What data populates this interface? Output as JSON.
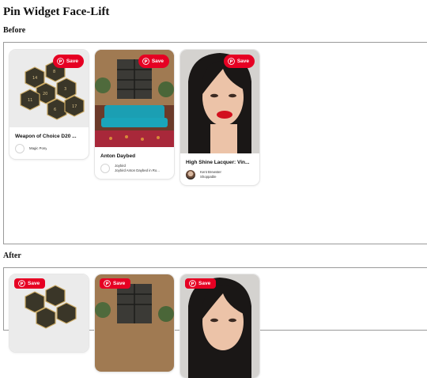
{
  "page": {
    "title": "Pin Widget Face-Lift"
  },
  "sections": {
    "before": {
      "heading": "Before"
    },
    "after": {
      "heading": "After"
    }
  },
  "pins": [
    {
      "title": "Weapon of Choice D20 ...",
      "attribution": [
        "Magic Pony"
      ],
      "save_label": "Save"
    },
    {
      "title": "Anton Daybed",
      "attribution": [
        "Joybird",
        "Joybird Anton Daybed in Ro..."
      ],
      "save_label": "Save"
    },
    {
      "title": "High Shine Lacquer: Vin...",
      "attribution": [
        "Kent Brewster",
        "Shoppable"
      ],
      "save_label": "Save"
    }
  ],
  "colors": {
    "save_red": "#e60023",
    "frame_border": "#9a9a9a"
  },
  "icons": {
    "save_icon": "pinterest-p-icon"
  }
}
